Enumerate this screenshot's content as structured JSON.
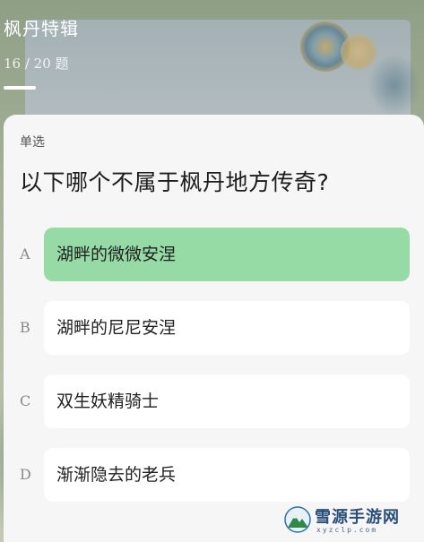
{
  "header": {
    "title": "枫丹特辑",
    "progress_text": "16 / 20 题",
    "progress_fraction": 0.8
  },
  "question": {
    "type_label": "单选",
    "text": "以下哪个不属于枫丹地方传奇?"
  },
  "options": [
    {
      "letter": "A",
      "text": "湖畔的微微安涅",
      "selected": true
    },
    {
      "letter": "B",
      "text": "湖畔的尼尼安涅",
      "selected": false
    },
    {
      "letter": "C",
      "text": "双生妖精骑士",
      "selected": false
    },
    {
      "letter": "D",
      "text": "渐渐隐去的老兵",
      "selected": false
    }
  ],
  "watermark": {
    "name": "雪源手游网",
    "url": "xyzclp.com"
  },
  "colors": {
    "selected_option": "#96dba6",
    "card_background": "#f6f6f6",
    "option_background": "#ffffff",
    "watermark_text": "#2a4e7a"
  }
}
